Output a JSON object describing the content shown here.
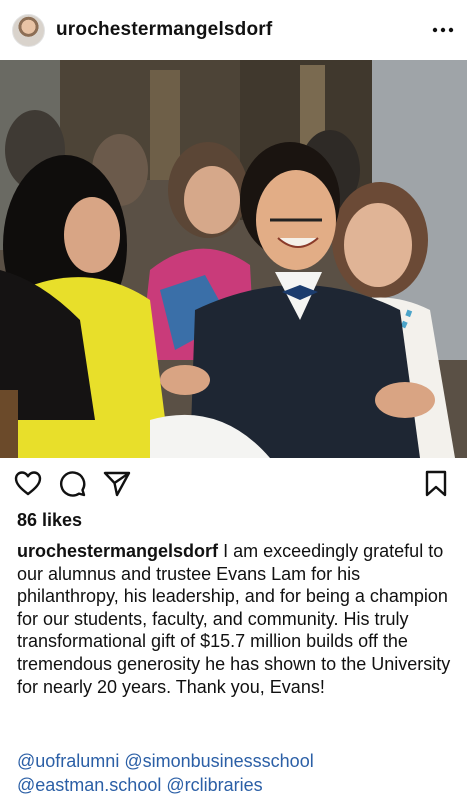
{
  "post": {
    "username": "urochestermangelsdorf",
    "more_icon": "more-horizontal-icon"
  },
  "photo": {
    "description_icon": "photo"
  },
  "actions": {
    "like_icon": "heart-outline-icon",
    "comment_icon": "comment-bubble-icon",
    "share_icon": "paper-plane-icon",
    "save_icon": "bookmark-outline-icon"
  },
  "likes": {
    "text": "86 likes"
  },
  "caption": {
    "username": "urochestermangelsdorf",
    "text": "I am exceedingly grateful to our alumnus and trustee Evans Lam for his philanthropy, his leadership, and for being a champion for our students, faculty, and community. His truly transformational gift of $15.7 million builds off the tremendous generosity he has shown to the University for nearly 20 years. Thank you, Evans!"
  },
  "mentions": [
    "@uofralumni",
    "@simonbusinessschool",
    "@eastman.school",
    "@rclibraries"
  ],
  "colors": {
    "mention": "#2b5fa6",
    "text": "#111111",
    "background": "#ffffff"
  }
}
